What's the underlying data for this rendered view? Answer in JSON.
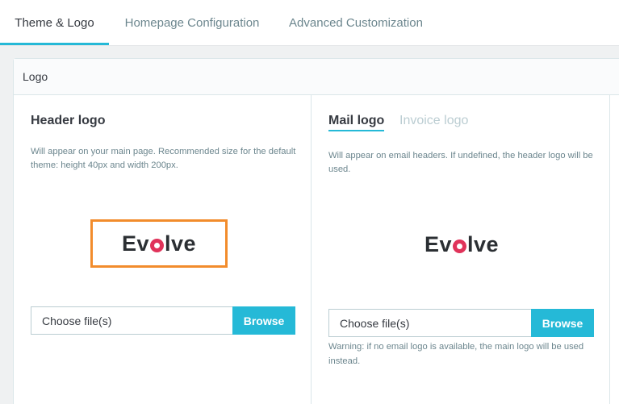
{
  "tabs": [
    {
      "label": "Theme & Logo",
      "active": true
    },
    {
      "label": "Homepage Configuration",
      "active": false
    },
    {
      "label": "Advanced Customization",
      "active": false
    }
  ],
  "card": {
    "title": "Logo"
  },
  "header_logo": {
    "title": "Header logo",
    "help": "Will appear on your main page. Recommended size for the default theme: height 40px and width 200px.",
    "logo_text_before": "Ev",
    "logo_text_after": "lve",
    "file_placeholder": "Choose file(s)",
    "browse_label": "Browse"
  },
  "mail_logo": {
    "subtabs": [
      {
        "label": "Mail logo",
        "active": true
      },
      {
        "label": "Invoice logo",
        "active": false
      }
    ],
    "help": "Will appear on email headers. If undefined, the header logo will be used.",
    "logo_text_before": "Ev",
    "logo_text_after": "lve",
    "file_placeholder": "Choose file(s)",
    "browse_label": "Browse",
    "warning": "Warning: if no email logo is available, the main logo will be used instead."
  },
  "colors": {
    "accent": "#25b9d7",
    "highlight": "#f28c2c",
    "logo_dot": "#e0335a"
  }
}
